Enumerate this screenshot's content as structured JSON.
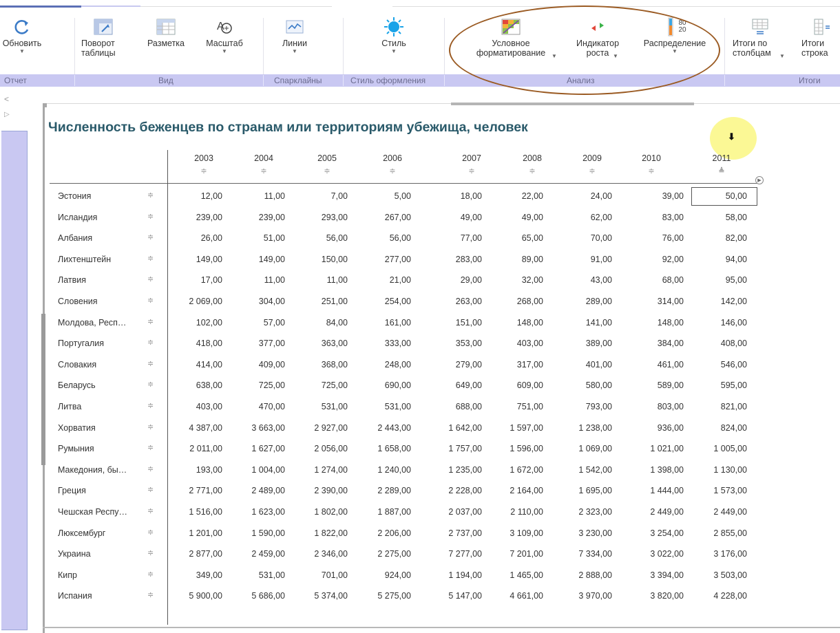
{
  "ribbon": {
    "buttons": [
      {
        "label": "Обновить",
        "dropdown": true
      },
      {
        "label": "Поворот\nтаблицы",
        "dropdown": false
      },
      {
        "label": "Разметка",
        "dropdown": false
      },
      {
        "label": "Масштаб",
        "dropdown": true
      },
      {
        "label": "Линии",
        "dropdown": true
      },
      {
        "label": "Стиль",
        "dropdown": true
      },
      {
        "label": "Условное\nформатирование",
        "dropdown": true
      },
      {
        "label": "Индикатор\nроста",
        "dropdown": true
      },
      {
        "label": "Распределение",
        "dropdown": true
      },
      {
        "label": "Итоги по\nстолбцам",
        "dropdown": true
      },
      {
        "label": "Итоги\nстрока",
        "dropdown": false
      }
    ],
    "distribution_icon_values": [
      "80",
      "20"
    ],
    "groups": [
      "Отчет",
      "Вид",
      "Спарклайны",
      "Стиль оформления",
      "Анализ",
      "Итоги"
    ]
  },
  "report": {
    "title": "Численность беженцев по странам или территориям убежища, человек",
    "years": [
      "2003",
      "2004",
      "2005",
      "2006",
      "2007",
      "2008",
      "2009",
      "2010",
      "2011"
    ],
    "sorted_year": "2011",
    "rows": [
      {
        "country": "Эстония",
        "values": [
          "12,00",
          "11,00",
          "7,00",
          "5,00",
          "18,00",
          "22,00",
          "24,00",
          "39,00",
          "50,00"
        ]
      },
      {
        "country": "Исландия",
        "values": [
          "239,00",
          "239,00",
          "293,00",
          "267,00",
          "49,00",
          "49,00",
          "62,00",
          "83,00",
          "58,00"
        ]
      },
      {
        "country": "Албания",
        "values": [
          "26,00",
          "51,00",
          "56,00",
          "56,00",
          "77,00",
          "65,00",
          "70,00",
          "76,00",
          "82,00"
        ]
      },
      {
        "country": "Лихтенштейн",
        "values": [
          "149,00",
          "149,00",
          "150,00",
          "277,00",
          "283,00",
          "89,00",
          "91,00",
          "92,00",
          "94,00"
        ]
      },
      {
        "country": "Латвия",
        "values": [
          "17,00",
          "11,00",
          "11,00",
          "21,00",
          "29,00",
          "32,00",
          "43,00",
          "68,00",
          "95,00"
        ]
      },
      {
        "country": "Словения",
        "values": [
          "2 069,00",
          "304,00",
          "251,00",
          "254,00",
          "263,00",
          "268,00",
          "289,00",
          "314,00",
          "142,00"
        ]
      },
      {
        "country": "Молдова, Респ…",
        "values": [
          "102,00",
          "57,00",
          "84,00",
          "161,00",
          "151,00",
          "148,00",
          "141,00",
          "148,00",
          "146,00"
        ]
      },
      {
        "country": "Португалия",
        "values": [
          "418,00",
          "377,00",
          "363,00",
          "333,00",
          "353,00",
          "403,00",
          "389,00",
          "384,00",
          "408,00"
        ]
      },
      {
        "country": "Словакия",
        "values": [
          "414,00",
          "409,00",
          "368,00",
          "248,00",
          "279,00",
          "317,00",
          "401,00",
          "461,00",
          "546,00"
        ]
      },
      {
        "country": "Беларусь",
        "values": [
          "638,00",
          "725,00",
          "725,00",
          "690,00",
          "649,00",
          "609,00",
          "580,00",
          "589,00",
          "595,00"
        ]
      },
      {
        "country": "Литва",
        "values": [
          "403,00",
          "470,00",
          "531,00",
          "531,00",
          "688,00",
          "751,00",
          "793,00",
          "803,00",
          "821,00"
        ]
      },
      {
        "country": "Хорватия",
        "values": [
          "4 387,00",
          "3 663,00",
          "2 927,00",
          "2 443,00",
          "1 642,00",
          "1 597,00",
          "1 238,00",
          "936,00",
          "824,00"
        ]
      },
      {
        "country": "Румыния",
        "values": [
          "2 011,00",
          "1 627,00",
          "2 056,00",
          "1 658,00",
          "1 757,00",
          "1 596,00",
          "1 069,00",
          "1 021,00",
          "1 005,00"
        ]
      },
      {
        "country": "Македония, бы…",
        "values": [
          "193,00",
          "1 004,00",
          "1 274,00",
          "1 240,00",
          "1 235,00",
          "1 672,00",
          "1 542,00",
          "1 398,00",
          "1 130,00"
        ]
      },
      {
        "country": "Греция",
        "values": [
          "2 771,00",
          "2 489,00",
          "2 390,00",
          "2 289,00",
          "2 228,00",
          "2 164,00",
          "1 695,00",
          "1 444,00",
          "1 573,00"
        ]
      },
      {
        "country": "Чешская Респу…",
        "values": [
          "1 516,00",
          "1 623,00",
          "1 802,00",
          "1 887,00",
          "2 037,00",
          "2 110,00",
          "2 323,00",
          "2 449,00",
          "2 449,00"
        ]
      },
      {
        "country": "Люксембург",
        "values": [
          "1 201,00",
          "1 590,00",
          "1 822,00",
          "2 206,00",
          "2 737,00",
          "3 109,00",
          "3 230,00",
          "3 254,00",
          "2 855,00"
        ]
      },
      {
        "country": "Украина",
        "values": [
          "2 877,00",
          "2 459,00",
          "2 346,00",
          "2 275,00",
          "7 277,00",
          "7 201,00",
          "7 334,00",
          "3 022,00",
          "3 176,00"
        ]
      },
      {
        "country": "Кипр",
        "values": [
          "349,00",
          "531,00",
          "701,00",
          "924,00",
          "1 194,00",
          "1 465,00",
          "2 888,00",
          "3 394,00",
          "3 503,00"
        ]
      },
      {
        "country": "Испания",
        "values": [
          "5 900,00",
          "5 686,00",
          "5 374,00",
          "5 275,00",
          "5 147,00",
          "4 661,00",
          "3 970,00",
          "3 820,00",
          "4 228,00"
        ]
      }
    ]
  }
}
